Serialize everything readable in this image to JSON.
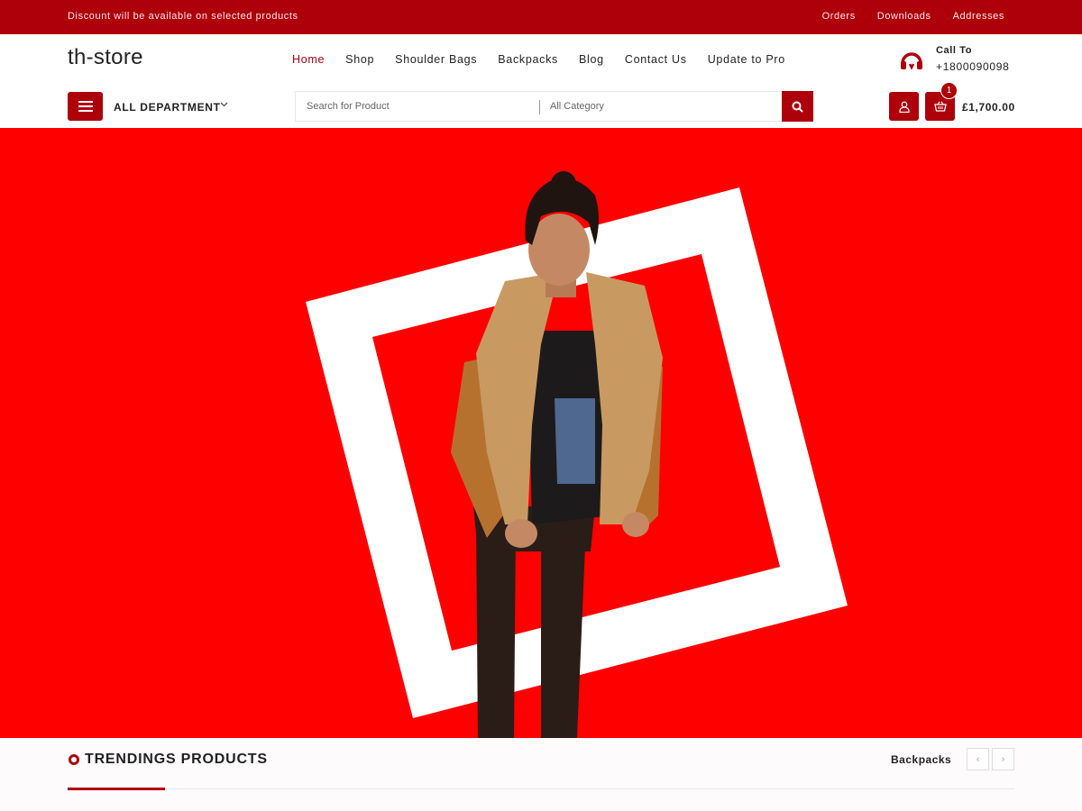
{
  "topbar": {
    "promo": "Discount will be available on selected products",
    "links": [
      "Orders",
      "Downloads",
      "Addresses"
    ]
  },
  "header": {
    "logo": "th-store",
    "nav": [
      "Home",
      "Shop",
      "Shoulder Bags",
      "Backpacks",
      "Blog",
      "Contact Us",
      "Update to Pro"
    ],
    "active_nav": "Home",
    "call_label": "Call To",
    "call_number": "+1800090098",
    "call_icon": "headphones-icon"
  },
  "toolbar": {
    "department_label": "ALL DEPARTMENT",
    "search_placeholder": "Search for Product",
    "category_label": "All Category",
    "cart_count": "1",
    "cart_total": "£1,700.00"
  },
  "trending": {
    "title": "TRENDINGS PRODUCTS",
    "category": "Backpacks",
    "prev": "‹",
    "next": "›"
  },
  "colors": {
    "brand": "#ad000b",
    "hero_bg": "#ff0000",
    "frame": "#ffffff"
  }
}
